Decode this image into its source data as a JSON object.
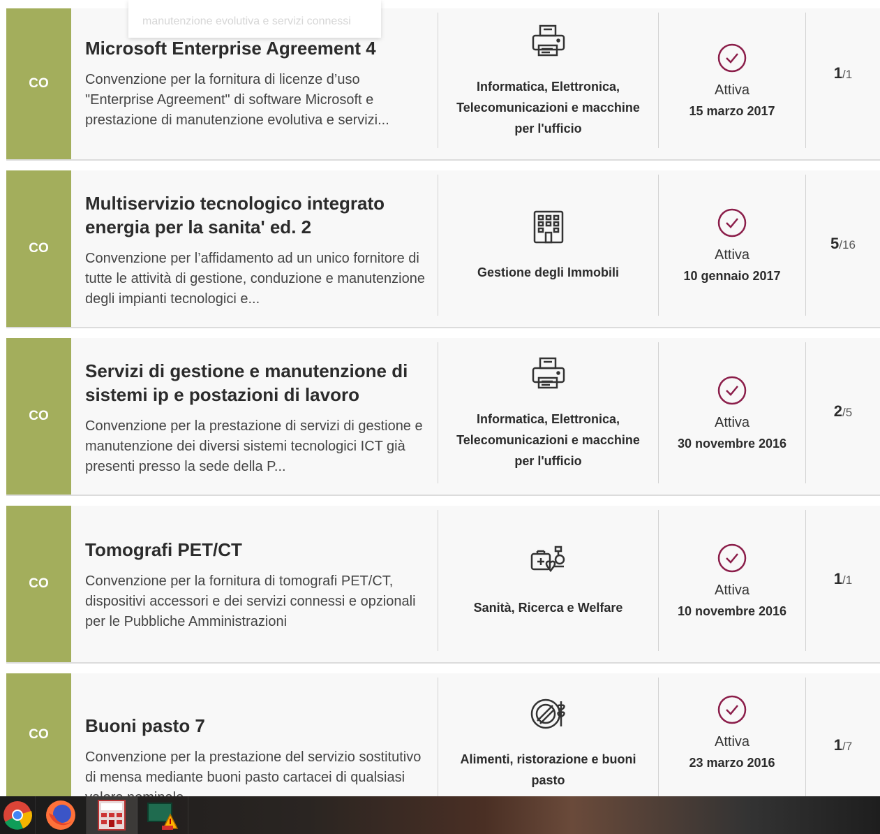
{
  "tooltip": {
    "text": "manutenzione evolutiva e servizi connessi"
  },
  "rows": [
    {
      "tag": "CO",
      "title": "Microsoft Enterprise Agreement 4",
      "description": "Convenzione per la fornitura di licenze d’uso \"Enterprise Agreement\" di software Microsoft e prestazione di manutenzione evolutiva e servizi...",
      "category": "Informatica, Elettronica, Telecomunicazioni e macchine per l'ufficio",
      "category_icon": "printer-icon",
      "status": "Attiva",
      "date": "15 marzo 2017",
      "count_active": "1",
      "count_total": "/1"
    },
    {
      "tag": "CO",
      "title": "Multiservizio tecnologico integrato energia per la sanita' ed. 2",
      "description": "Convenzione per l’affidamento ad un unico fornitore di tutte le attività di gestione, conduzione e manutenzione degli impianti tecnologici e...",
      "category": "Gestione degli Immobili",
      "category_icon": "building-icon",
      "status": "Attiva",
      "date": "10 gennaio 2017",
      "count_active": "5",
      "count_total": "/16"
    },
    {
      "tag": "CO",
      "title": "Servizi di gestione e manutenzione di sistemi ip e postazioni di lavoro",
      "description": "Convenzione per la prestazione di servizi di gestione e manutenzione dei diversi sistemi tecnologici ICT già presenti presso la sede della P...",
      "category": "Informatica, Elettronica, Telecomunicazioni e macchine per l'ufficio",
      "category_icon": "printer-icon",
      "status": "Attiva",
      "date": "30 novembre 2016",
      "count_active": "2",
      "count_total": "/5"
    },
    {
      "tag": "CO",
      "title": "Tomografi PET/CT",
      "description": "Convenzione per la fornitura di tomografi PET/CT, dispositivi accessori e dei servizi connessi e opzionali per le Pubbliche Amministrazioni",
      "category": "Sanità, Ricerca e Welfare",
      "category_icon": "health-icon",
      "status": "Attiva",
      "date": "10 novembre 2016",
      "count_active": "1",
      "count_total": "/1"
    },
    {
      "tag": "CO",
      "title": "Buoni pasto 7",
      "description": "Convenzione per la prestazione del servizio sostitutivo di mensa mediante buoni pasto cartacei di qualsiasi valore nominale",
      "category": "Alimenti, ristorazione e buoni pasto",
      "category_icon": "food-icon",
      "status": "Attiva",
      "date": "23 marzo 2016",
      "count_active": "1",
      "count_total": "/7"
    }
  ],
  "taskbar": {
    "apps": [
      "chrome-icon",
      "firefox-icon",
      "calculator-app-icon",
      "alert-app-icon"
    ]
  },
  "colors": {
    "tag_bg": "#a3ae5c",
    "status_icon": "#8b1e4a"
  }
}
